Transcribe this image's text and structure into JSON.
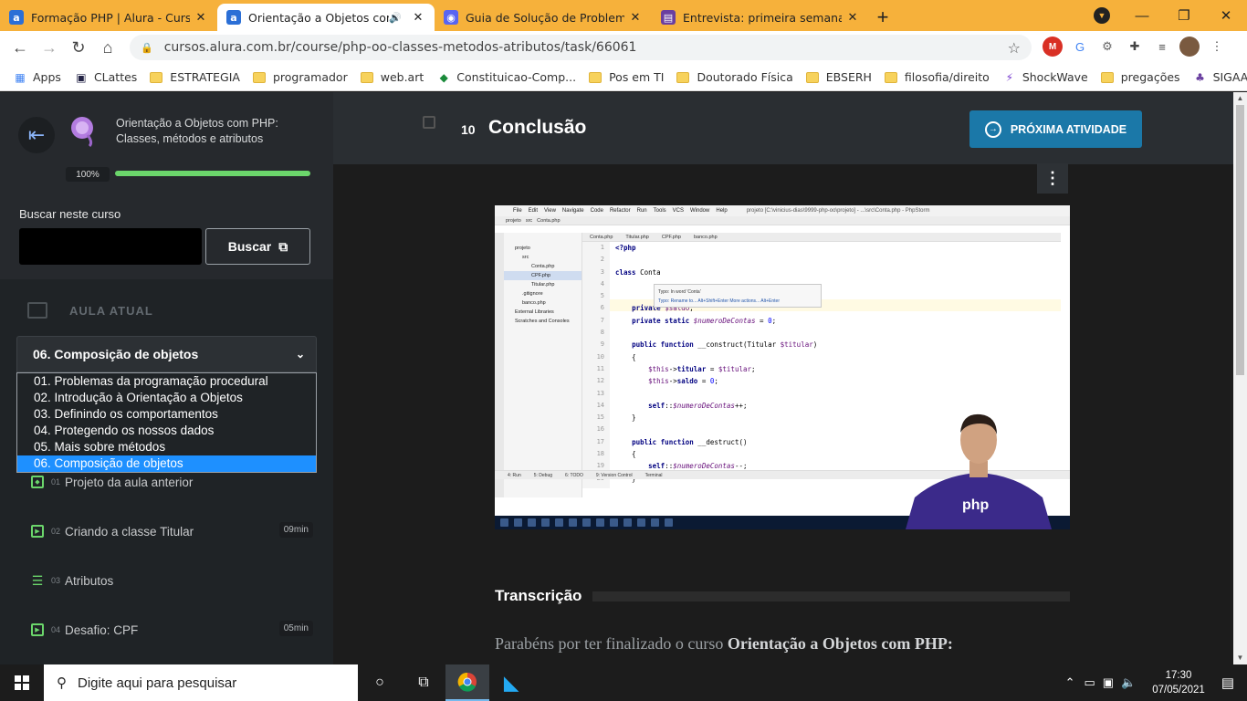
{
  "browser": {
    "tabs": [
      {
        "title": "Formação PHP | Alura - Cursos on",
        "favicon": "alura-icon",
        "active": false
      },
      {
        "title": "Orientação a Objetos com PHP",
        "favicon": "alura-icon",
        "active": true,
        "audio": true
      },
      {
        "title": "Guia de Solução de Problema de",
        "favicon": "discord-icon",
        "active": false
      },
      {
        "title": "Entrevista: primeira semana de w",
        "favicon": "video-icon",
        "active": false
      }
    ],
    "url": "cursos.alura.com.br/course/php-oo-classes-metodos-atributos/task/66061",
    "bookmarks": [
      "Apps",
      "CLattes",
      "ESTRATEGIA",
      "programador",
      "web.art",
      "Constituicao-Comp...",
      "Pos em TI",
      "Doutorado Física",
      "EBSERH",
      "filosofia/direito",
      "ShockWave",
      "pregações",
      "SIGAA -"
    ]
  },
  "sidebar": {
    "course_title_line1": "Orientação a Objetos com PHP:",
    "course_title_line2": "Classes, métodos e atributos",
    "progress_label": "100%",
    "progress": 1.0,
    "search_label": "Buscar neste curso",
    "search_button": "Buscar",
    "current_label": "AULA ATUAL",
    "selected_module": "06. Composição de objetos",
    "modules": [
      "01. Problemas da programação procedural",
      "02. Introdução à Orientação a Objetos",
      "03. Definindo os comportamentos",
      "04. Protegendo os nossos dados",
      "05. Mais sobre métodos",
      "06. Composição de objetos"
    ],
    "lessons": [
      {
        "num": "01",
        "title": "Projeto da aula anterior",
        "duration": ""
      },
      {
        "num": "02",
        "title": "Criando a classe Titular",
        "duration": "09min"
      },
      {
        "num": "03",
        "title": "Atributos",
        "duration": ""
      },
      {
        "num": "04",
        "title": "Desafio: CPF",
        "duration": "05min"
      }
    ]
  },
  "main": {
    "task_number": "10",
    "task_title": "Conclusão",
    "next_button": "PRÓXIMA ATIVIDADE",
    "transcript_title": "Transcrição",
    "transcript_text_plain": "Parabéns por ter finalizado o curso ",
    "transcript_text_bold": "Orientação a Objetos com PHP:"
  },
  "video": {
    "menu": [
      "File",
      "Edit",
      "View",
      "Navigate",
      "Code",
      "Refactor",
      "Run",
      "Tools",
      "VCS",
      "Window",
      "Help"
    ],
    "window_title": "projeto [C:\\vinicius-dias\\9999-php-oo\\projeto] - ...\\src\\Conta.php - PhpStorm",
    "editor_tabs": [
      "Conta.php",
      "Titular.php",
      "CPF.php",
      "banco.php"
    ],
    "project_tree": [
      "projeto",
      "src",
      "Conta.php",
      "CPF.php",
      "Titular.php",
      ".gitignore",
      "banco.php",
      "External Libraries",
      "Scratches and Consoles"
    ],
    "tooltip_line1": "Typo: In word 'Conta'",
    "tooltip_line2": "Typo: Rename to...  Alt+Shift+Enter   More actions...  Alt+Enter",
    "bottom_tabs": [
      "4: Run",
      "5: Debug",
      "6: TODO",
      "9: Version Control",
      "Terminal"
    ]
  },
  "taskbar": {
    "search_placeholder": "Digite aqui para pesquisar",
    "time": "17:30",
    "date": "07/05/2021"
  }
}
